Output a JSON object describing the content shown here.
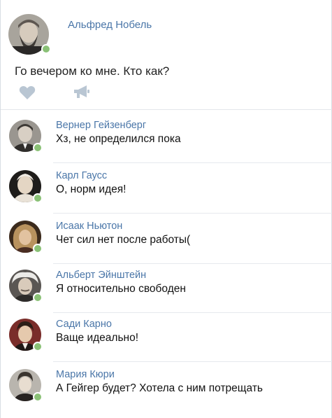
{
  "post": {
    "author": "Альфред Нобель",
    "text": "Го вечером ко мне. Кто как?",
    "author_online": true
  },
  "actions": {
    "like_icon": "heart-icon",
    "share_icon": "megaphone-icon"
  },
  "comments": [
    {
      "author": "Вернер Гейзенберг",
      "text": "Хз, не определился пока",
      "online": true
    },
    {
      "author": "Карл Гаусс",
      "text": "О, норм идея!",
      "online": true
    },
    {
      "author": "Исаак Ньютон",
      "text": "Чет сил нет после работы(",
      "online": true
    },
    {
      "author": "Альберт Эйнштейн",
      "text": "Я относительно свободен",
      "online": true
    },
    {
      "author": "Сади Карно",
      "text": "Ваще идеально!",
      "online": true
    },
    {
      "author": "Мария Кюри",
      "text": "А Гейгер будет? Хотела с ним потрещать",
      "online": true
    }
  ],
  "colors": {
    "link": "#4a76a8",
    "online": "#8ac176",
    "icon": "#b9c6d3"
  }
}
